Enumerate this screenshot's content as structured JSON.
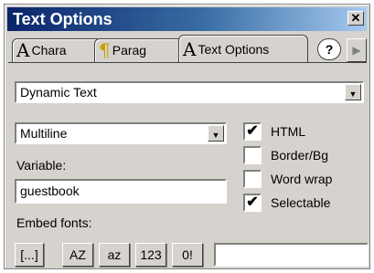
{
  "window": {
    "title": "Text Options",
    "close_icon": "close-icon"
  },
  "tabs": [
    {
      "label": "Chara",
      "glyph": "A",
      "active": false
    },
    {
      "label": "Parag",
      "glyph": "¶",
      "active": false
    },
    {
      "label": "Text Options",
      "glyph": "A",
      "active": true
    }
  ],
  "help_glyph": "?",
  "scroll_glyph": "▶",
  "text_type": {
    "value": "Dynamic Text"
  },
  "line_type": {
    "value": "Multiline"
  },
  "variable": {
    "label": "Variable:",
    "value": "guestbook"
  },
  "options": [
    {
      "label": "HTML",
      "checked": true
    },
    {
      "label": "Border/Bg",
      "checked": false
    },
    {
      "label": "Word wrap",
      "checked": false
    },
    {
      "label": "Selectable",
      "checked": true
    }
  ],
  "embed": {
    "label": "Embed fonts:",
    "buttons": [
      "[...]",
      "AZ",
      "az",
      "123",
      "0!"
    ],
    "field_value": ""
  }
}
